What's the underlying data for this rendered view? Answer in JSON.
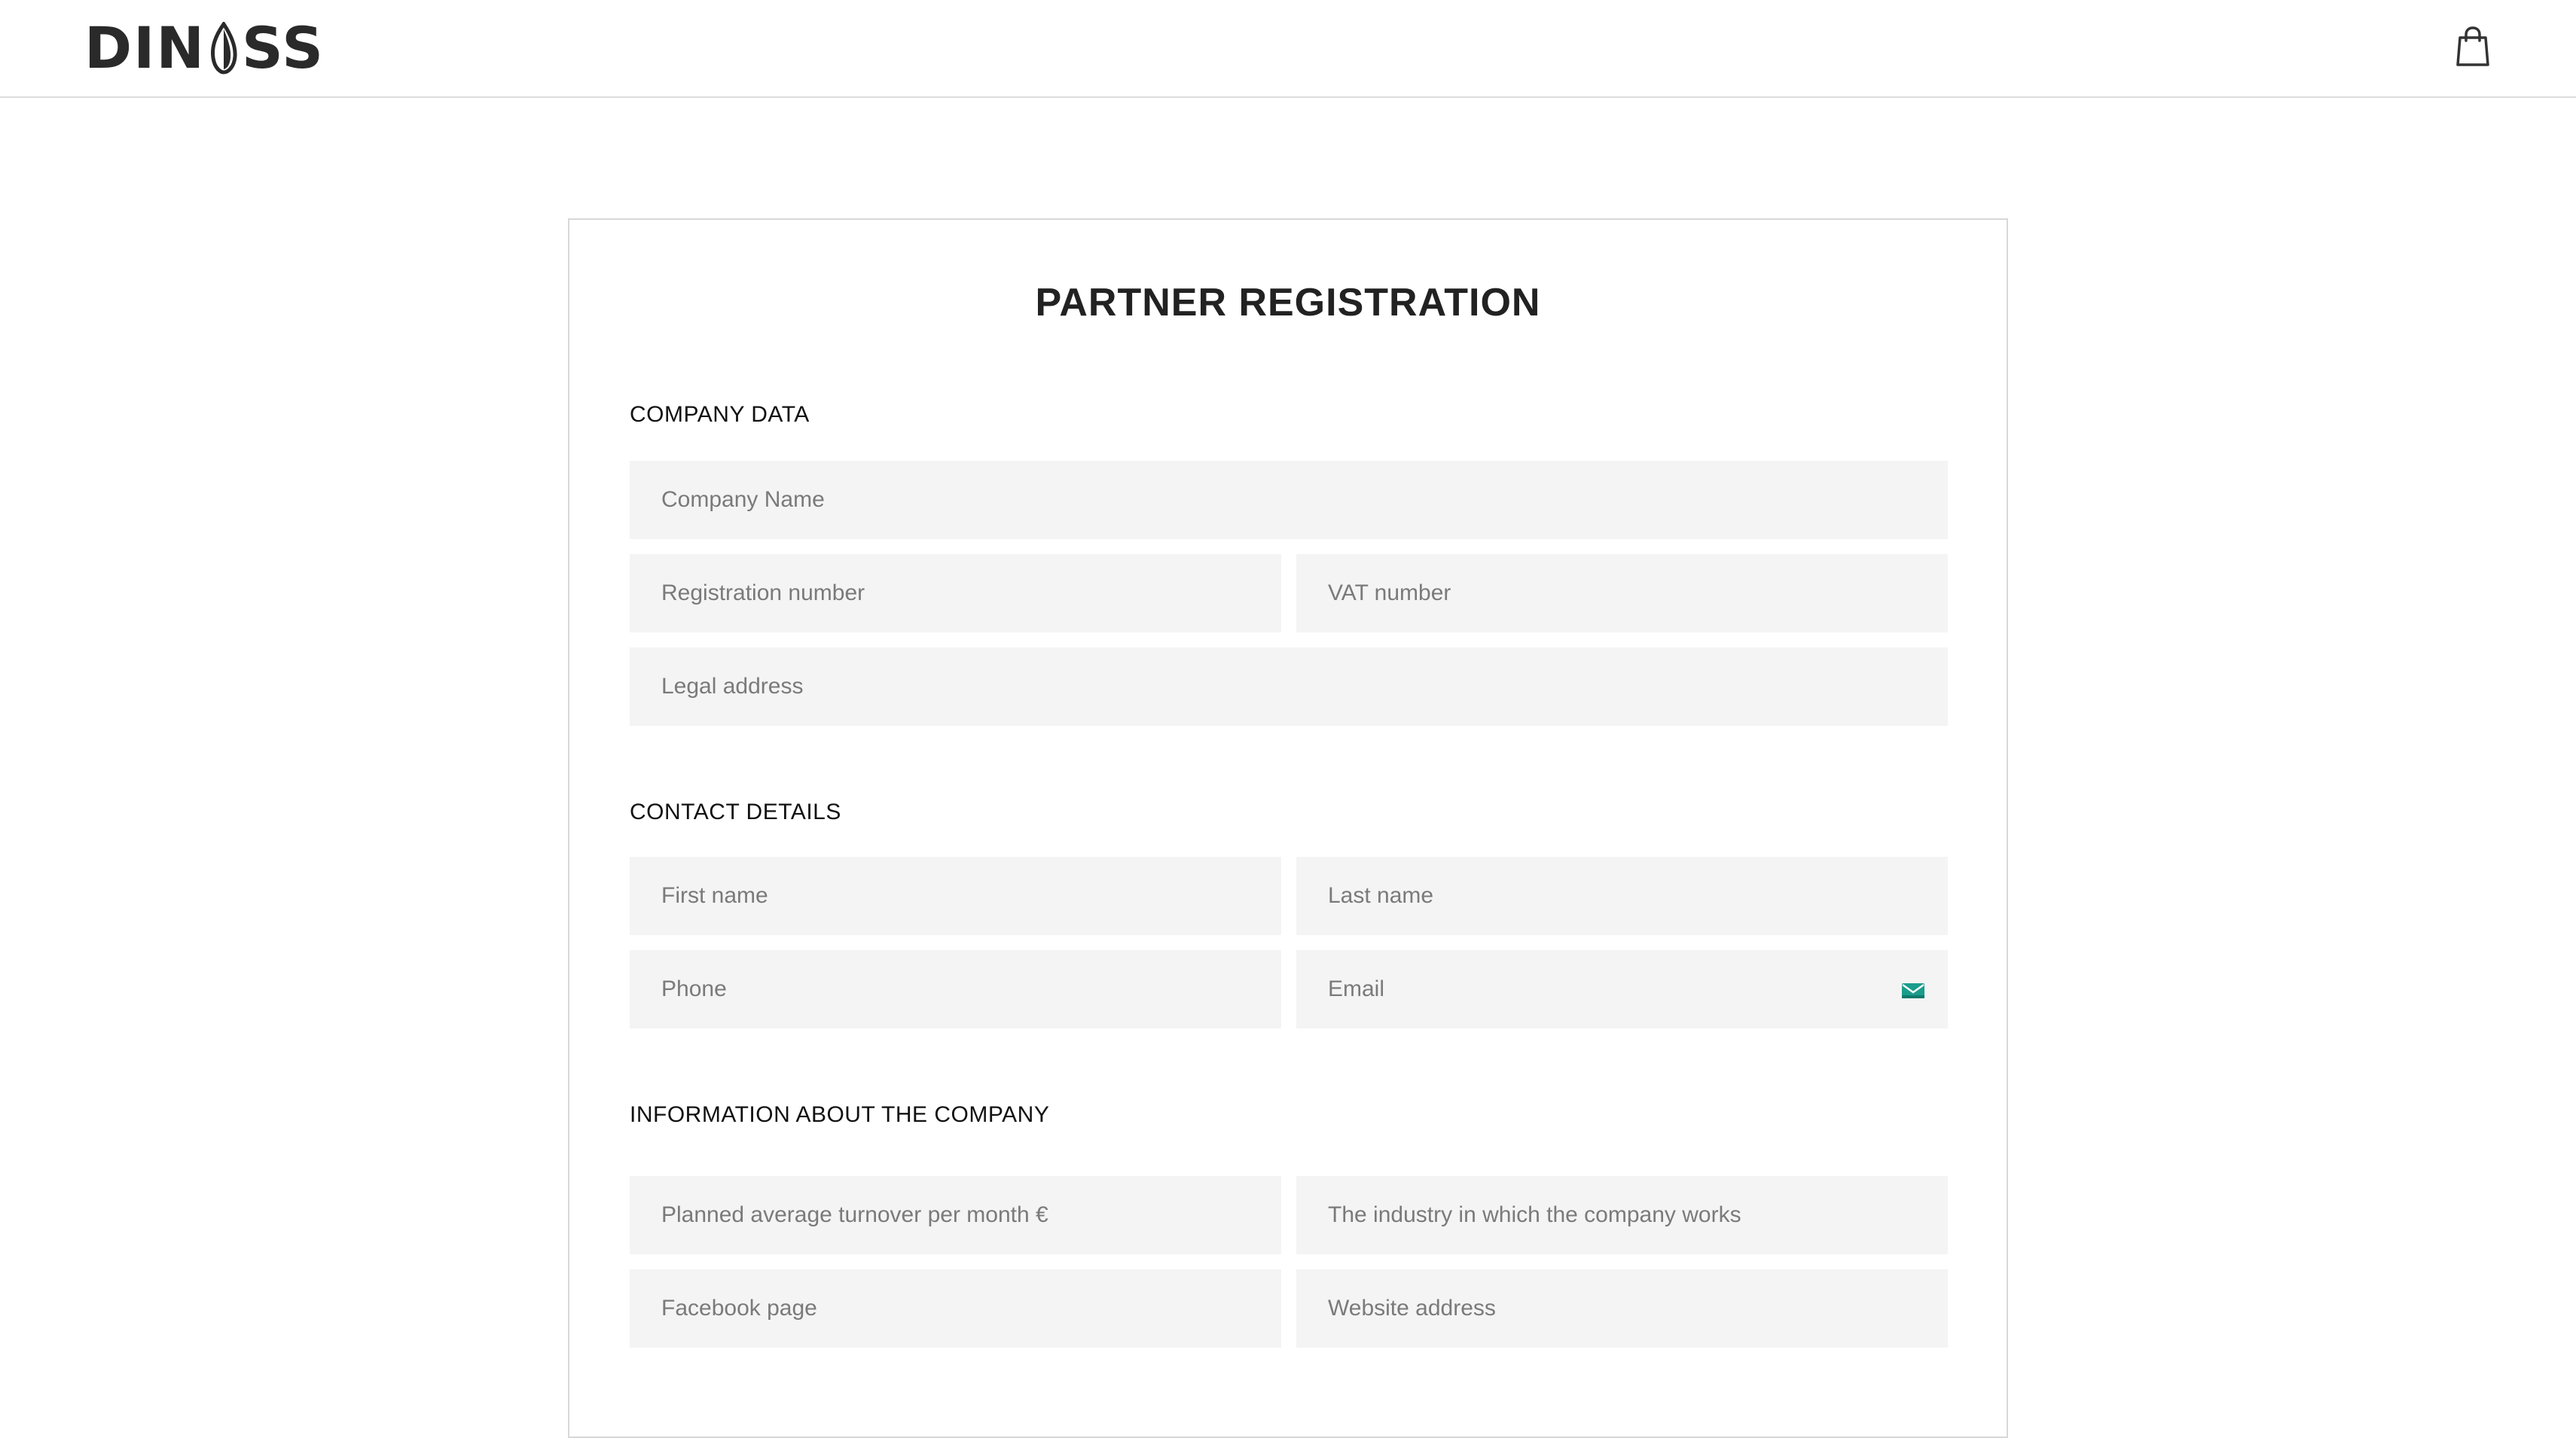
{
  "header": {
    "logo_left": "DIN",
    "logo_right": "SS",
    "cart_icon": "shopping-bag-icon"
  },
  "form": {
    "title": "PARTNER REGISTRATION",
    "sections": {
      "company_data": {
        "title": "COMPANY DATA",
        "company_name_placeholder": "Company Name",
        "registration_number_placeholder": "Registration number",
        "vat_number_placeholder": "VAT number",
        "legal_address_placeholder": "Legal address"
      },
      "contact_details": {
        "title": "CONTACT DETAILS",
        "first_name_placeholder": "First name",
        "last_name_placeholder": "Last name",
        "phone_placeholder": "Phone",
        "email_placeholder": "Email",
        "email_icon": "envelope-icon"
      },
      "company_info": {
        "title": "INFORMATION ABOUT THE COMPANY",
        "turnover_placeholder": "Planned average turnover per month €",
        "industry_placeholder": "The industry in which the company works",
        "facebook_placeholder": "Facebook page",
        "website_placeholder": "Website address"
      }
    }
  },
  "colors": {
    "field_background": "#f4f4f4",
    "border": "#d8d8d8",
    "text": "#222222",
    "placeholder": "#7a7a7a",
    "email_icon_accent": "#1a9c8c"
  }
}
